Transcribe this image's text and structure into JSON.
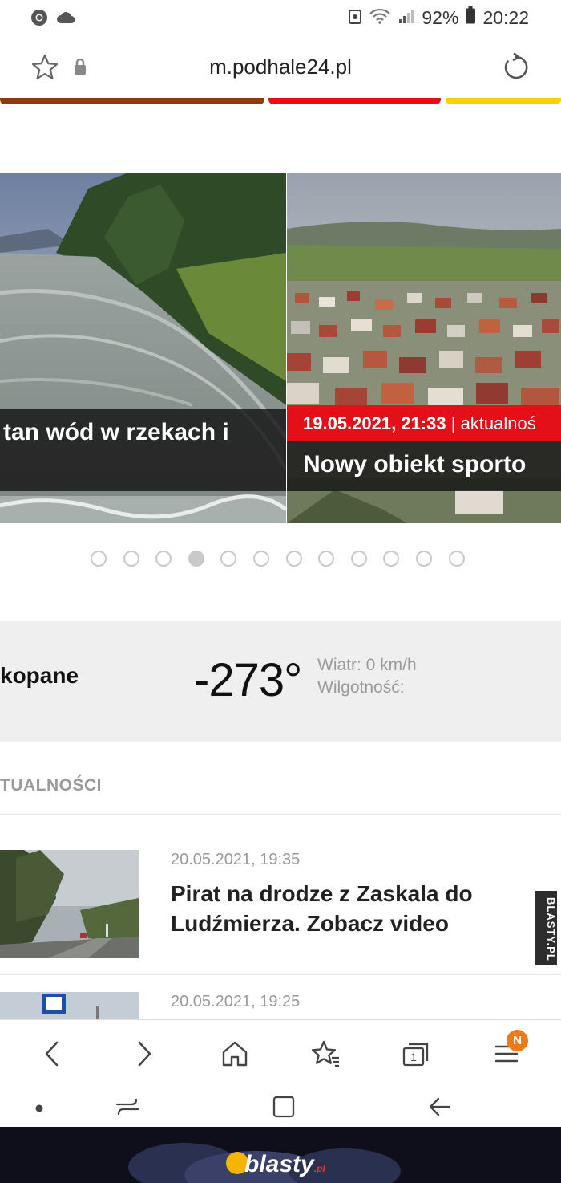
{
  "status": {
    "battery": "92%",
    "time": "20:22"
  },
  "browser": {
    "url": "m.podhale24.pl"
  },
  "slides": [
    {
      "title": "tan wód w rzekach i"
    },
    {
      "date": "19.05.2021, 21:33",
      "category": "aktualnoś",
      "title": "Nowy obiekt sporto"
    }
  ],
  "slider_dots": {
    "count": 12,
    "active_index": 3
  },
  "weather": {
    "city": "kopane",
    "temperature": "-273°",
    "wind": "Wiatr: 0 km/h",
    "humidity": "Wilgotność:"
  },
  "news": {
    "section_title": "TUALNOŚCI",
    "articles": [
      {
        "date": "20.05.2021, 19:35",
        "title": "Pirat na drodze z Zaskala do Ludźmierza. Zobacz video"
      },
      {
        "date": "20.05.2021, 19:25"
      }
    ]
  },
  "browser_nav": {
    "menu_badge": "N"
  },
  "watermark": {
    "side": "BLASTY.PL",
    "brand": "blasty",
    "tld": ".pl"
  },
  "colors": {
    "accent_red": "#e3101a",
    "strip_brown": "#8b3a10",
    "strip_red": "#e3101a",
    "strip_yellow": "#f5d20c",
    "badge_orange": "#f07a1a"
  },
  "icons": [
    "chrome-icon",
    "cloud-icon",
    "star-icon",
    "lock-icon",
    "reload-icon",
    "back-icon",
    "forward-icon",
    "home-icon",
    "bookmarks-icon",
    "tabs-icon",
    "menu-icon"
  ]
}
